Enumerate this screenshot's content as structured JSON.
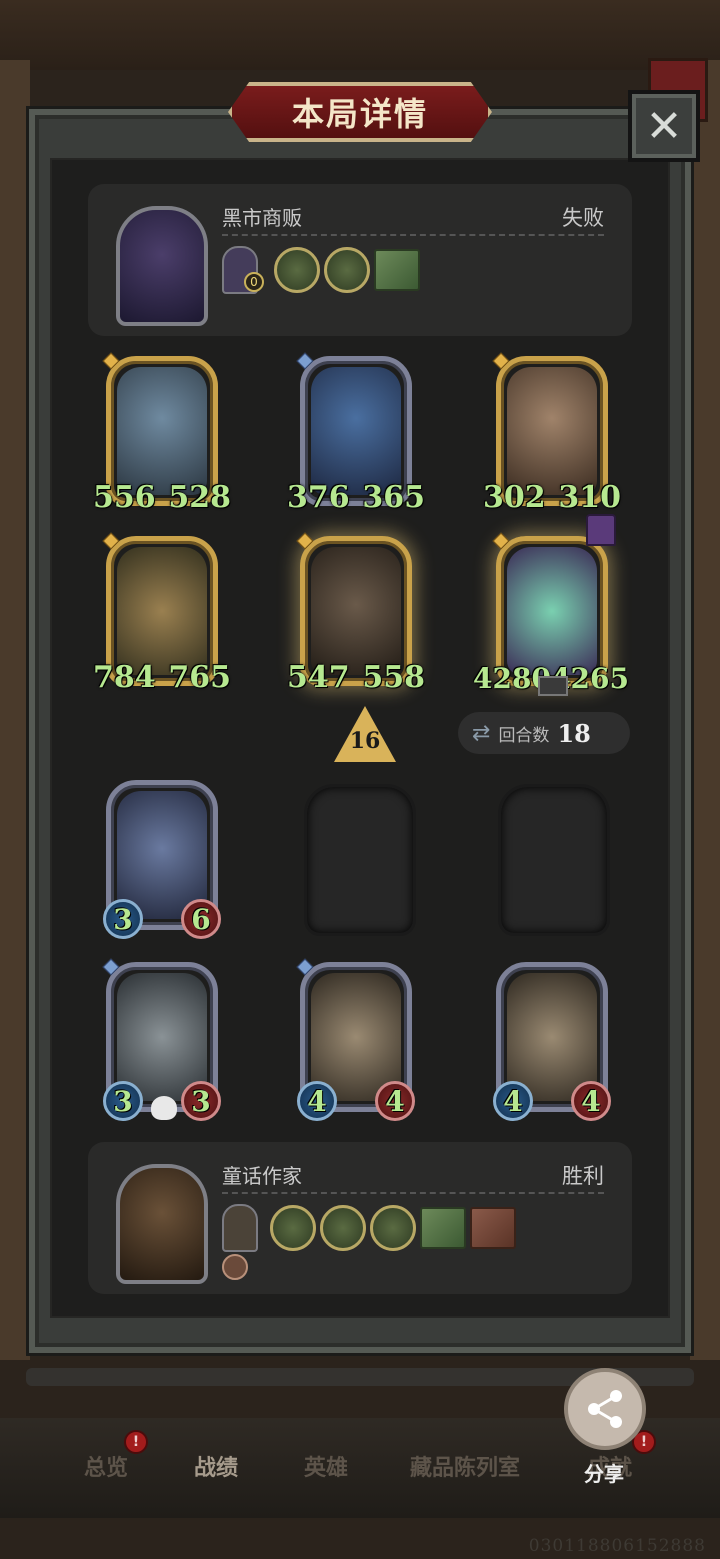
{
  "header": {
    "title": "本局详情",
    "close_symbol": "✕"
  },
  "opponent": {
    "name": "黑市商贩",
    "result": "失败",
    "hero_level": "0"
  },
  "opponent_board": [
    {
      "attack": "556",
      "health": "528",
      "frame": "gold"
    },
    {
      "attack": "376",
      "health": "365",
      "frame": "silver"
    },
    {
      "attack": "302",
      "health": "310",
      "frame": "gold"
    },
    {
      "attack": "784",
      "health": "765",
      "frame": "gold"
    },
    {
      "attack": "547",
      "health": "558",
      "frame": "gold"
    },
    {
      "attack": "4280",
      "health": "4265",
      "frame": "gold"
    }
  ],
  "tier": "16",
  "round": {
    "label": "回合数",
    "value": "18"
  },
  "my_board": [
    {
      "attack": "3",
      "health": "6"
    },
    {
      "attack": "3",
      "health": "3"
    },
    {
      "attack": "4",
      "health": "4"
    },
    {
      "attack": "4",
      "health": "4"
    }
  ],
  "me": {
    "name": "童话作家",
    "result": "胜利"
  },
  "nav": {
    "items": [
      "总览",
      "战绩",
      "英雄",
      "藏品陈列室",
      "成就"
    ],
    "active": "战绩",
    "alert_mark": "!"
  },
  "share": {
    "label": "分享"
  },
  "uid": "030118806152888",
  "colors": {
    "stat_green": "#b6e890",
    "title_red": "#6b1c1c",
    "gold_frame": "#c9a24a"
  }
}
